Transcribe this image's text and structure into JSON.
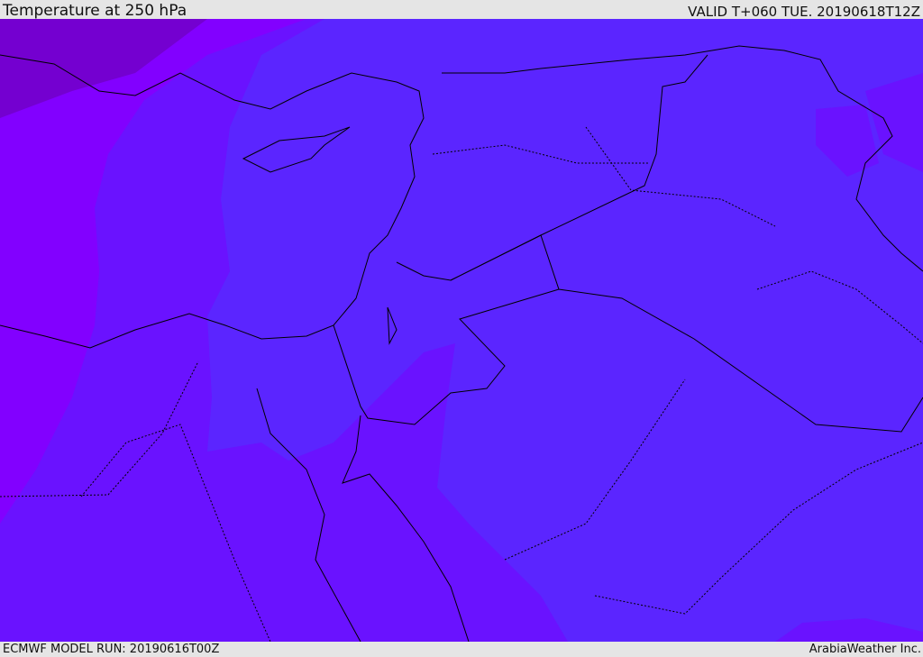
{
  "header": {
    "title": "Temperature at 250 hPa",
    "valid": "VALID T+060 TUE. 20190618T12Z"
  },
  "footer": {
    "model_run": "ECMWF MODEL RUN: 20190616T00Z",
    "brand": "ArabiaWeather Inc."
  },
  "colors": {
    "main": "#5b25ff",
    "mid": "#6a12ff",
    "warm": "#8200ff",
    "dark": "#7400d0"
  }
}
